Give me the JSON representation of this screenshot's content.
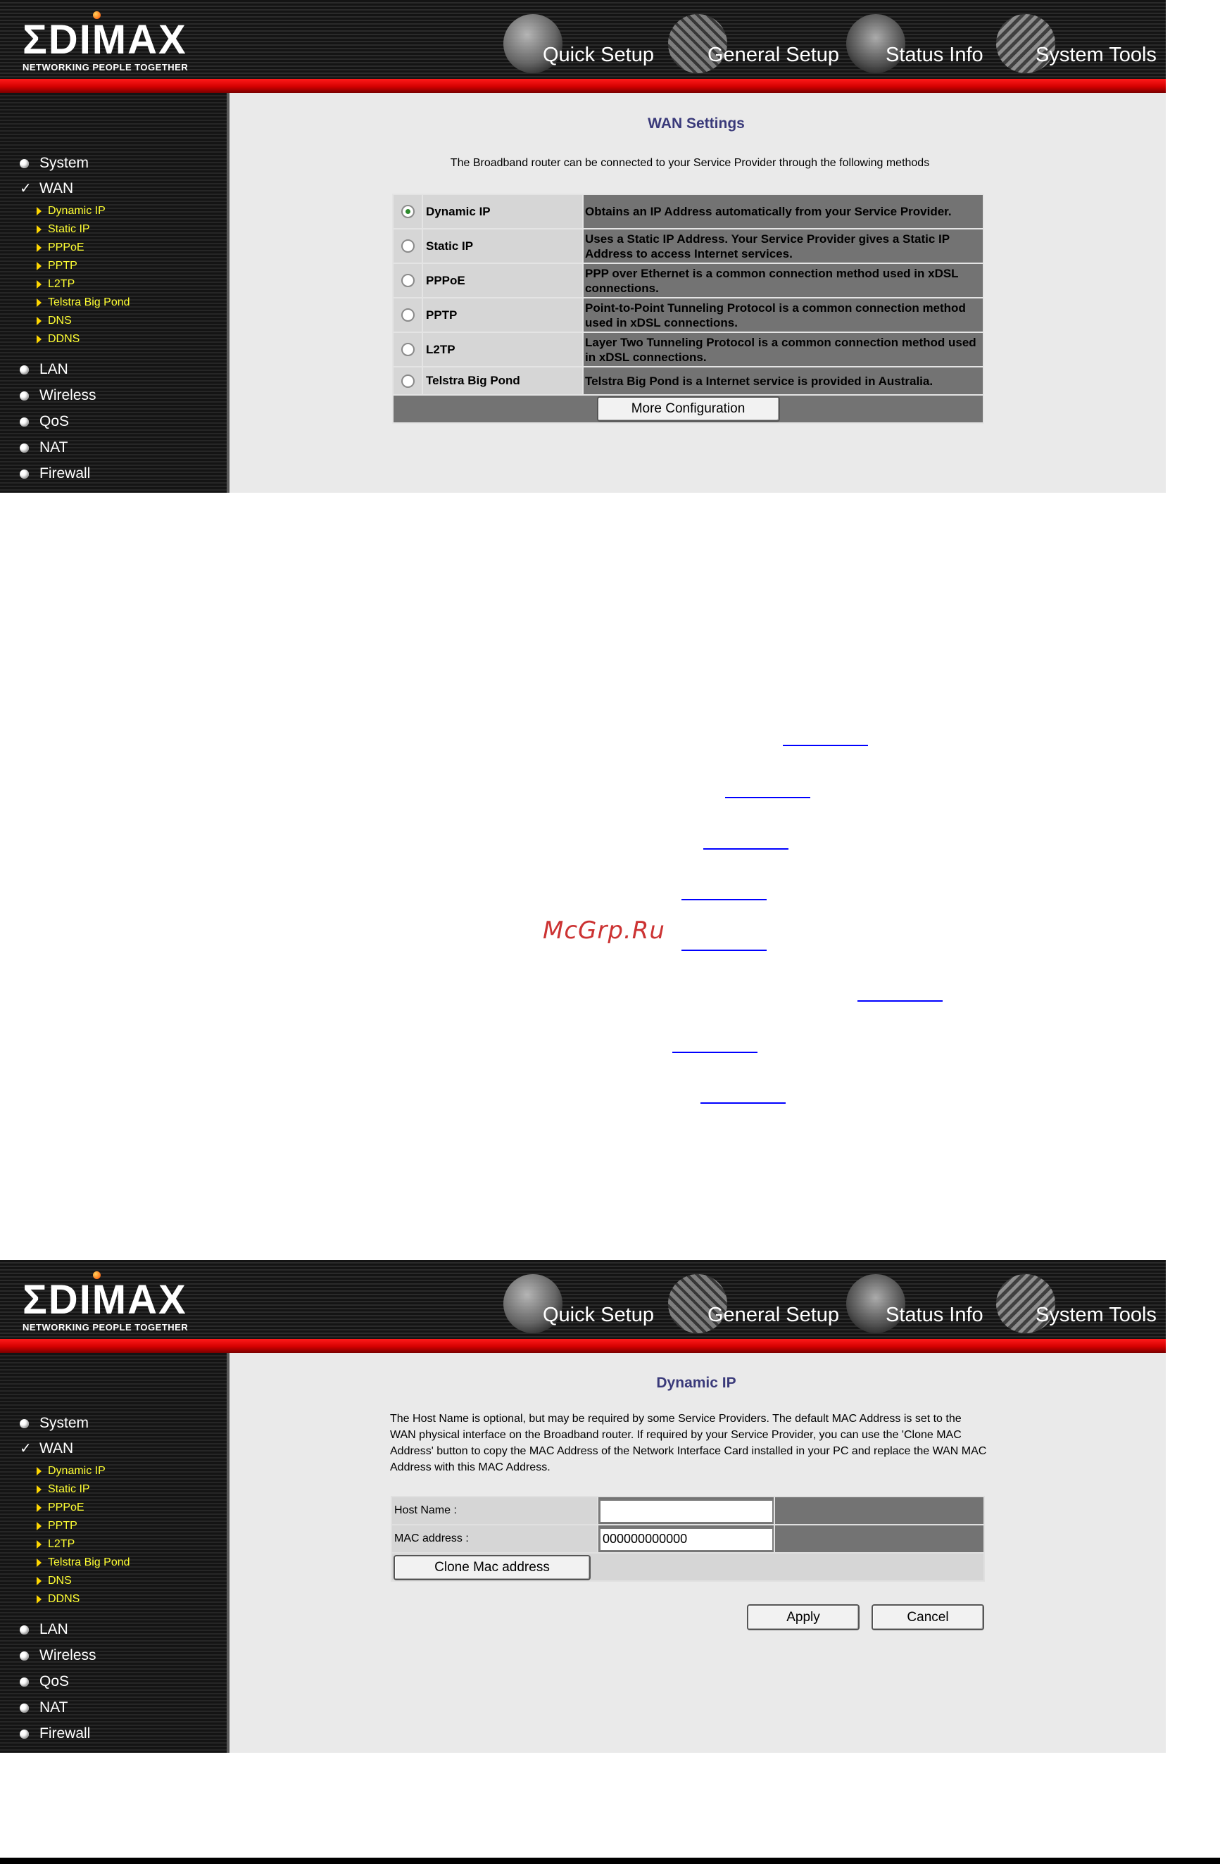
{
  "brand": {
    "logo_text": "ΣDIMAX",
    "tagline": "NETWORKING PEOPLE TOGETHER"
  },
  "nav": [
    "Quick Setup",
    "General Setup",
    "Status Info",
    "System Tools"
  ],
  "sidebar": {
    "main_items": [
      "System",
      "WAN",
      "LAN",
      "Wireless",
      "QoS",
      "NAT",
      "Firewall"
    ],
    "wan_sub_items": [
      "Dynamic IP",
      "Static IP",
      "PPPoE",
      "PPTP",
      "L2TP",
      "Telstra Big Pond",
      "DNS",
      "DDNS"
    ]
  },
  "wan_settings": {
    "title": "WAN Settings",
    "intro": "The Broadband router can be connected to your Service Provider through the following methods",
    "options": [
      {
        "name": "Dynamic IP",
        "desc": "Obtains an IP Address automatically from your Service Provider.",
        "selected": true
      },
      {
        "name": "Static IP",
        "desc": "Uses a Static IP Address. Your Service Provider gives a Static IP Address to access Internet services.",
        "selected": false
      },
      {
        "name": "PPPoE",
        "desc": "PPP over Ethernet is a common connection method used in xDSL connections.",
        "selected": false
      },
      {
        "name": "PPTP",
        "desc": "Point-to-Point Tunneling Protocol is a common connection method used in xDSL connections.",
        "selected": false
      },
      {
        "name": "L2TP",
        "desc": "Layer Two Tunneling Protocol is a common connection method used in xDSL connections.",
        "selected": false
      },
      {
        "name": "Telstra Big Pond",
        "desc": "Telstra Big Pond is a Internet service is provided in Australia.",
        "selected": false
      }
    ],
    "more_button": "More Configuration"
  },
  "watermark": "McGrp.Ru",
  "dynamic_ip": {
    "title": "Dynamic IP",
    "intro": "The Host Name is optional, but may be required by some Service Providers. The default MAC Address is set to the WAN physical interface on the Broadband router. If required by your Service Provider, you can use the 'Clone MAC Address' button to copy the MAC Address of the Network Interface Card installed in your PC and replace the WAN MAC Address with this MAC Address.",
    "host_name_label": "Host Name :",
    "host_name_value": "",
    "mac_label": "MAC address :",
    "mac_value": "000000000000",
    "clone_button": "Clone Mac address",
    "apply_button": "Apply",
    "cancel_button": "Cancel"
  }
}
